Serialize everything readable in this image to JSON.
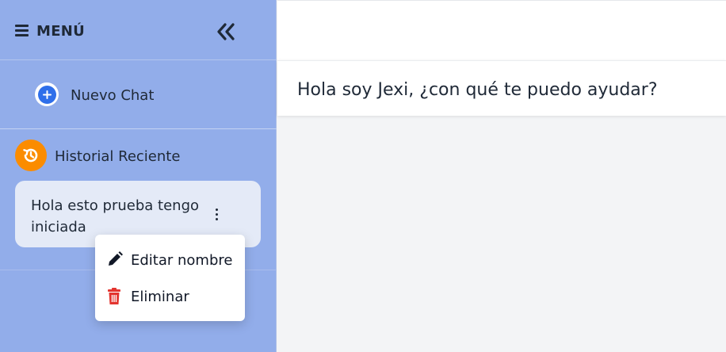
{
  "sidebar": {
    "menu_title": "MENÚ",
    "new_chat_label": "Nuevo Chat",
    "history_label": "Historial Reciente",
    "chats": [
      {
        "title": "Hola esto prueba tengo iniciada"
      }
    ]
  },
  "context_menu": {
    "edit_label": "Editar nombre",
    "delete_label": "Eliminar"
  },
  "main": {
    "greeting": "Hola soy Jexi, ¿con qué te puedo ayudar?"
  },
  "colors": {
    "sidebar_bg": "#92adea",
    "accent_blue": "#2f6fea",
    "history_orange": "#fb8c00",
    "delete_red": "#e3342f"
  },
  "icons": {
    "menu": "hamburger-icon",
    "collapse": "double-chevron-left-icon",
    "new_chat": "plus-circle-icon",
    "history": "history-icon",
    "options": "kebab-icon",
    "edit": "pencil-icon",
    "delete": "trash-icon"
  }
}
